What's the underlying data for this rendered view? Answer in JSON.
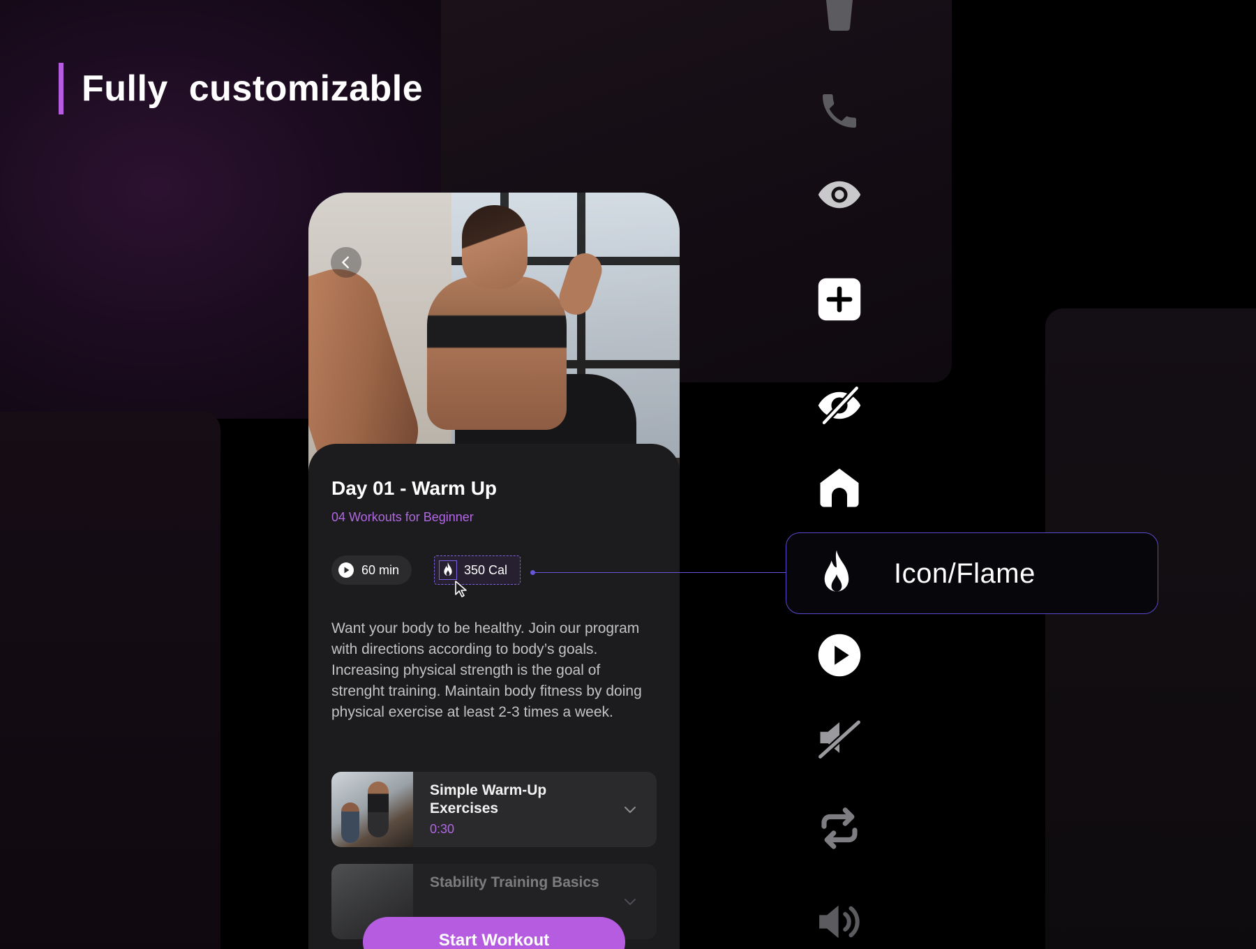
{
  "header": {
    "title": "Fully  customizable"
  },
  "workout": {
    "title": "Day 01 - Warm Up",
    "subtitle": "04 Workouts for Beginner",
    "duration": "60 min",
    "calories": "350 Cal",
    "description": "Want your body to be healthy. Join our program with directions according to body’s goals. Increasing physical strength is the goal of strenght training. Maintain body fitness by doing physical exercise at least 2-3 times a week.",
    "exercises": [
      {
        "name": "Simple Warm-Up Exercises",
        "duration": "0:30"
      },
      {
        "name": "Stability Training Basics",
        "duration": ""
      }
    ],
    "start_label": "Start Workout"
  },
  "icon_library": {
    "icons": [
      "bottle-icon",
      "phone-icon",
      "eye-icon",
      "plus-square-icon",
      "eye-off-icon",
      "home-icon",
      "flame-icon",
      "play-circle-icon",
      "mute-icon",
      "repeat-icon",
      "volume-icon"
    ],
    "selected_label": "Icon/Flame"
  },
  "colors": {
    "accent": "#b65ce0",
    "highlight": "#5a4ad0",
    "background": "#000000",
    "card": "#1c1c1e"
  }
}
